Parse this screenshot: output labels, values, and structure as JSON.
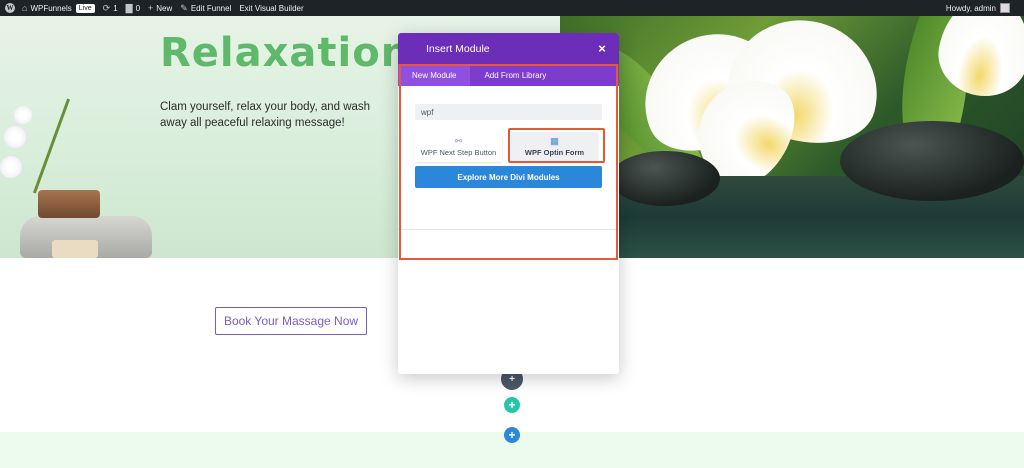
{
  "adminbar": {
    "wp_logo": "W",
    "site_name": "WPFunnels",
    "live_badge": "Live",
    "updates_count": "1",
    "comments_count": "0",
    "new_label": "New",
    "edit_funnel_label": "Edit Funnel",
    "exit_builder_label": "Exit Visual Builder",
    "howdy_label": "Howdy, admin",
    "icons": {
      "updates": "refresh-icon",
      "comments": "comment-icon",
      "new": "plus-icon"
    }
  },
  "hero": {
    "title": "Relaxation",
    "text": "Clam yourself, relax your body, and wash away all peaceful relaxing message!"
  },
  "cta": {
    "book_label": "Book Your Massage Now"
  },
  "modal": {
    "title": "Insert Module",
    "close_glyph": "×",
    "tabs": [
      {
        "label": "New Module",
        "active": true
      },
      {
        "label": "Add From Library",
        "active": false
      }
    ],
    "search_value": "wpf",
    "modules": [
      {
        "label": "WPF Next Step Button",
        "icon": "link-icon"
      },
      {
        "label": "WPF Optin Form",
        "icon": "form-icon"
      }
    ],
    "explore_label": "Explore More Divi Modules"
  },
  "builder_controls": {
    "plus_glyph": "+"
  },
  "colors": {
    "admin_bar": "#1d2327",
    "modal_header": "#6c2eb9",
    "modal_tabs": "#7e3bd0",
    "highlight": "#e5583a",
    "primary_blue": "#2b87da",
    "teal": "#29c4a9",
    "title_green": "#5fb96a",
    "cta_purple": "#7a5cc7"
  }
}
